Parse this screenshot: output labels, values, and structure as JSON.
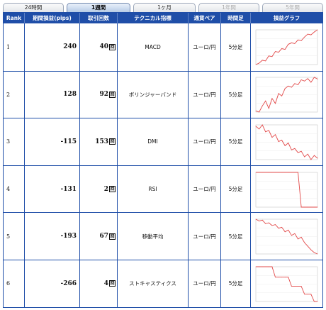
{
  "tabs": [
    {
      "label": "24時間",
      "state": "normal"
    },
    {
      "label": "1週間",
      "state": "active"
    },
    {
      "label": "1ヶ月",
      "state": "normal"
    },
    {
      "label": "1年間",
      "state": "disabled"
    },
    {
      "label": "5年間",
      "state": "disabled"
    }
  ],
  "headers": {
    "rank": "Rank",
    "pips": "期間損益(pips)",
    "count": "取引回数",
    "indicator": "テクニカル指標",
    "pair": "通貨ペア",
    "timeframe": "時間足",
    "graph": "損益グラフ"
  },
  "count_unit": "回",
  "colors": {
    "header_bg": "#1f4ea8",
    "border": "#1f4ea8",
    "chart_line": "#e24848",
    "active_tab": "#b7cbe6"
  },
  "rows": [
    {
      "rank": "1",
      "pips": "240",
      "count": "40",
      "indicator": "MACD",
      "pair": "ユーロ/円",
      "timeframe": "5分足"
    },
    {
      "rank": "2",
      "pips": "128",
      "count": "92",
      "indicator": "ボリンジャーバンド",
      "pair": "ユーロ/円",
      "timeframe": "5分足"
    },
    {
      "rank": "3",
      "pips": "-115",
      "count": "153",
      "indicator": "DMI",
      "pair": "ユーロ/円",
      "timeframe": "5分足"
    },
    {
      "rank": "4",
      "pips": "-131",
      "count": "2",
      "indicator": "RSI",
      "pair": "ユーロ/円",
      "timeframe": "5分足"
    },
    {
      "rank": "5",
      "pips": "-193",
      "count": "67",
      "indicator": "移動平均",
      "pair": "ユーロ/円",
      "timeframe": "5分足"
    },
    {
      "rank": "6",
      "pips": "-266",
      "count": "4",
      "indicator": "ストキャスティクス",
      "pair": "ユーロ/円",
      "timeframe": "5分足"
    }
  ],
  "chart_data": [
    {
      "type": "line",
      "values": [
        0,
        10,
        30,
        25,
        60,
        55,
        90,
        85,
        110,
        105,
        140,
        150,
        145,
        170,
        165,
        190,
        210,
        205,
        225,
        240
      ]
    },
    {
      "type": "line",
      "values": [
        0,
        -5,
        20,
        40,
        10,
        50,
        30,
        70,
        60,
        90,
        100,
        95,
        110,
        105,
        125,
        120,
        130,
        115,
        135,
        128
      ]
    },
    {
      "type": "line",
      "values": [
        0,
        -10,
        5,
        -20,
        -15,
        -40,
        -30,
        -55,
        -50,
        -70,
        -60,
        -85,
        -80,
        -95,
        -90,
        -110,
        -100,
        -120,
        -105,
        -115
      ]
    },
    {
      "type": "line",
      "values": [
        0,
        0,
        0,
        0,
        0,
        0,
        0,
        0,
        0,
        0,
        0,
        0,
        0,
        0,
        -131,
        -131,
        -131,
        -131,
        -131,
        -131
      ]
    },
    {
      "type": "line",
      "values": [
        0,
        -10,
        -5,
        -25,
        -20,
        -35,
        -30,
        -50,
        -45,
        -70,
        -60,
        -90,
        -80,
        -110,
        -100,
        -130,
        -150,
        -170,
        -185,
        -193
      ]
    },
    {
      "type": "line",
      "values": [
        0,
        0,
        0,
        0,
        0,
        0,
        -80,
        -80,
        -80,
        -80,
        -80,
        -150,
        -150,
        -150,
        -150,
        -210,
        -210,
        -210,
        -266,
        -266
      ]
    }
  ]
}
